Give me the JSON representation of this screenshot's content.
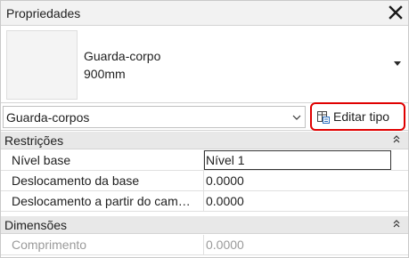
{
  "panel": {
    "title": "Propriedades"
  },
  "type_selector": {
    "family": "Guarda-corpo",
    "type": "900mm"
  },
  "filter": {
    "selected": "Guarda-corpos"
  },
  "edit_type": {
    "label": "Editar tipo"
  },
  "sections": [
    {
      "label": "Restrições",
      "rows": [
        {
          "name": "Nível base",
          "value": "Nível 1"
        },
        {
          "name": "Deslocamento da base",
          "value": "0.0000"
        },
        {
          "name": "Deslocamento a partir do cam…",
          "value": "0.0000"
        }
      ]
    },
    {
      "label": "Dimensões",
      "rows": [
        {
          "name": "Comprimento",
          "value": "0.0000"
        }
      ]
    }
  ],
  "colors": {
    "highlight_border": "#e00000",
    "section_bg": "#e8e8e8",
    "disabled_text": "#9a9a9a"
  },
  "icons": {
    "close": "close-icon",
    "type_dropdown": "caret-down-icon",
    "filter_dropdown": "chevron-down-icon",
    "edit_type": "edit-type-icon",
    "collapse": "collapse-up-icon"
  }
}
